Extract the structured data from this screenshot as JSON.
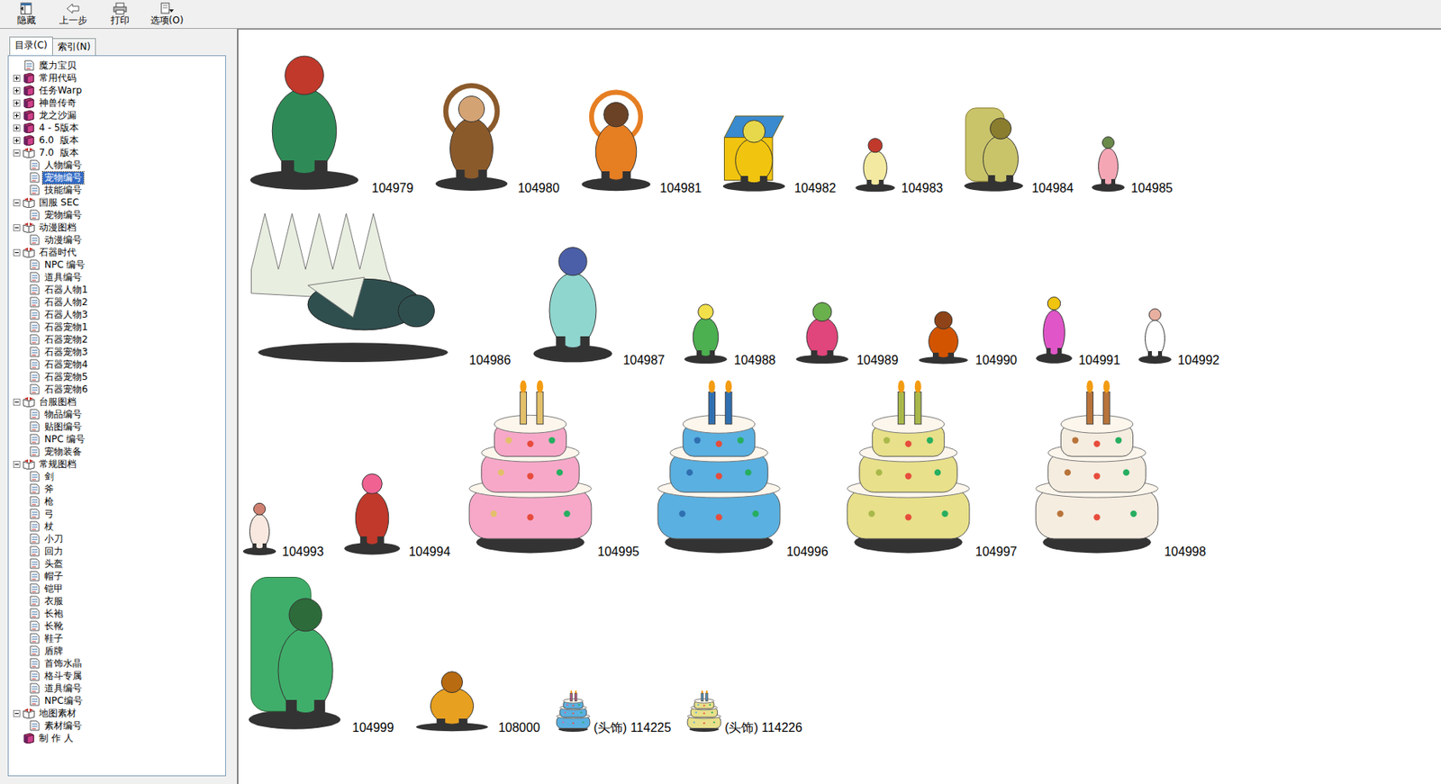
{
  "toolbar": [
    {
      "label": "隐藏"
    },
    {
      "label": "上一步"
    },
    {
      "label": "打印"
    },
    {
      "label": "选项(O)"
    }
  ],
  "tabs": [
    {
      "label": "目录(C)",
      "selected": true
    },
    {
      "label": "索引(N)",
      "selected": false
    }
  ],
  "sidebar": {
    "items": [
      {
        "label": "魔力宝贝",
        "selected": false
      },
      {
        "label": "常用代码",
        "expanded": false,
        "selected": false
      },
      {
        "label": "任务Warp",
        "expanded": false,
        "selected": false
      },
      {
        "label": "神兽传奇",
        "expanded": false,
        "selected": false
      },
      {
        "label": "龙之沙漏",
        "expanded": false,
        "selected": false
      },
      {
        "label": "4 - 5版本",
        "expanded": false,
        "selected": false
      },
      {
        "label": "6.0  版本",
        "expanded": false,
        "selected": false
      },
      {
        "label": "7.0  版本",
        "expanded": true,
        "selected": false,
        "children": [
          {
            "label": "人物编号",
            "selected": false
          },
          {
            "label": "宠物编号",
            "selected": true
          },
          {
            "label": "技能编号",
            "selected": false
          }
        ]
      },
      {
        "label": "国服 SEC",
        "expanded": true,
        "selected": false,
        "children": [
          {
            "label": "宠物编号",
            "selected": false
          }
        ]
      },
      {
        "label": "动漫图档",
        "expanded": true,
        "selected": false,
        "children": [
          {
            "label": "动漫编号",
            "selected": false
          }
        ]
      },
      {
        "label": "石器时代",
        "expanded": true,
        "selected": false,
        "children": [
          {
            "label": "NPC 编号",
            "selected": false
          },
          {
            "label": "道具编号",
            "selected": false
          },
          {
            "label": "石器人物1",
            "selected": false
          },
          {
            "label": "石器人物2",
            "selected": false
          },
          {
            "label": "石器人物3",
            "selected": false
          },
          {
            "label": "石器宠物1",
            "selected": false
          },
          {
            "label": "石器宠物2",
            "selected": false
          },
          {
            "label": "石器宠物3",
            "selected": false
          },
          {
            "label": "石器宠物4",
            "selected": false
          },
          {
            "label": "石器宠物5",
            "selected": false
          },
          {
            "label": "石器宠物6",
            "selected": false
          }
        ]
      },
      {
        "label": "台服图档",
        "expanded": true,
        "selected": false,
        "children": [
          {
            "label": "物品编号",
            "selected": false
          },
          {
            "label": "贴图编号",
            "selected": false
          },
          {
            "label": "NPC 编号",
            "selected": false
          },
          {
            "label": "宠物装备",
            "selected": false
          }
        ]
      },
      {
        "label": "常规图档",
        "expanded": true,
        "selected": false,
        "children": [
          {
            "label": "剑",
            "selected": false
          },
          {
            "label": "斧",
            "selected": false
          },
          {
            "label": "枪",
            "selected": false
          },
          {
            "label": "弓",
            "selected": false
          },
          {
            "label": "杖",
            "selected": false
          },
          {
            "label": "小刀",
            "selected": false
          },
          {
            "label": "回力",
            "selected": false
          },
          {
            "label": "头盔",
            "selected": false
          },
          {
            "label": "帽子",
            "selected": false
          },
          {
            "label": "铠甲",
            "selected": false
          },
          {
            "label": "衣服",
            "selected": false
          },
          {
            "label": "长袍",
            "selected": false
          },
          {
            "label": "长靴",
            "selected": false
          },
          {
            "label": "鞋子",
            "selected": false
          },
          {
            "label": "盾牌",
            "selected": false
          },
          {
            "label": "首饰水晶",
            "selected": false
          },
          {
            "label": "格斗专属",
            "selected": false
          },
          {
            "label": "道具编号",
            "selected": false
          },
          {
            "label": "NPC编号",
            "selected": false
          }
        ]
      },
      {
        "label": "地图素材",
        "expanded": true,
        "selected": false,
        "children": [
          {
            "label": "素材编号",
            "selected": false
          }
        ]
      },
      {
        "label": "制 作 人",
        "selected": false
      }
    ]
  },
  "content": {
    "rows": [
      {
        "items": [
          {
            "label": "104979"
          },
          {
            "label": "104980"
          },
          {
            "label": "104981"
          },
          {
            "label": "104982"
          },
          {
            "label": "104983"
          },
          {
            "label": "104984"
          },
          {
            "label": "104985"
          }
        ]
      },
      {
        "items": [
          {
            "label": "104986"
          },
          {
            "label": "104987"
          },
          {
            "label": "104988"
          },
          {
            "label": "104989"
          },
          {
            "label": "104990"
          },
          {
            "label": "104991"
          },
          {
            "label": "104992"
          }
        ]
      },
      {
        "items": [
          {
            "label": "104993"
          },
          {
            "label": "104994"
          },
          {
            "label": "104995"
          },
          {
            "label": "104996"
          },
          {
            "label": "104997"
          },
          {
            "label": "104998"
          }
        ]
      },
      {
        "items": [
          {
            "label": "104999"
          },
          {
            "label": "108000"
          },
          {
            "label": "(头饰) 114225"
          },
          {
            "label": "(头饰) 114226"
          }
        ]
      }
    ]
  }
}
